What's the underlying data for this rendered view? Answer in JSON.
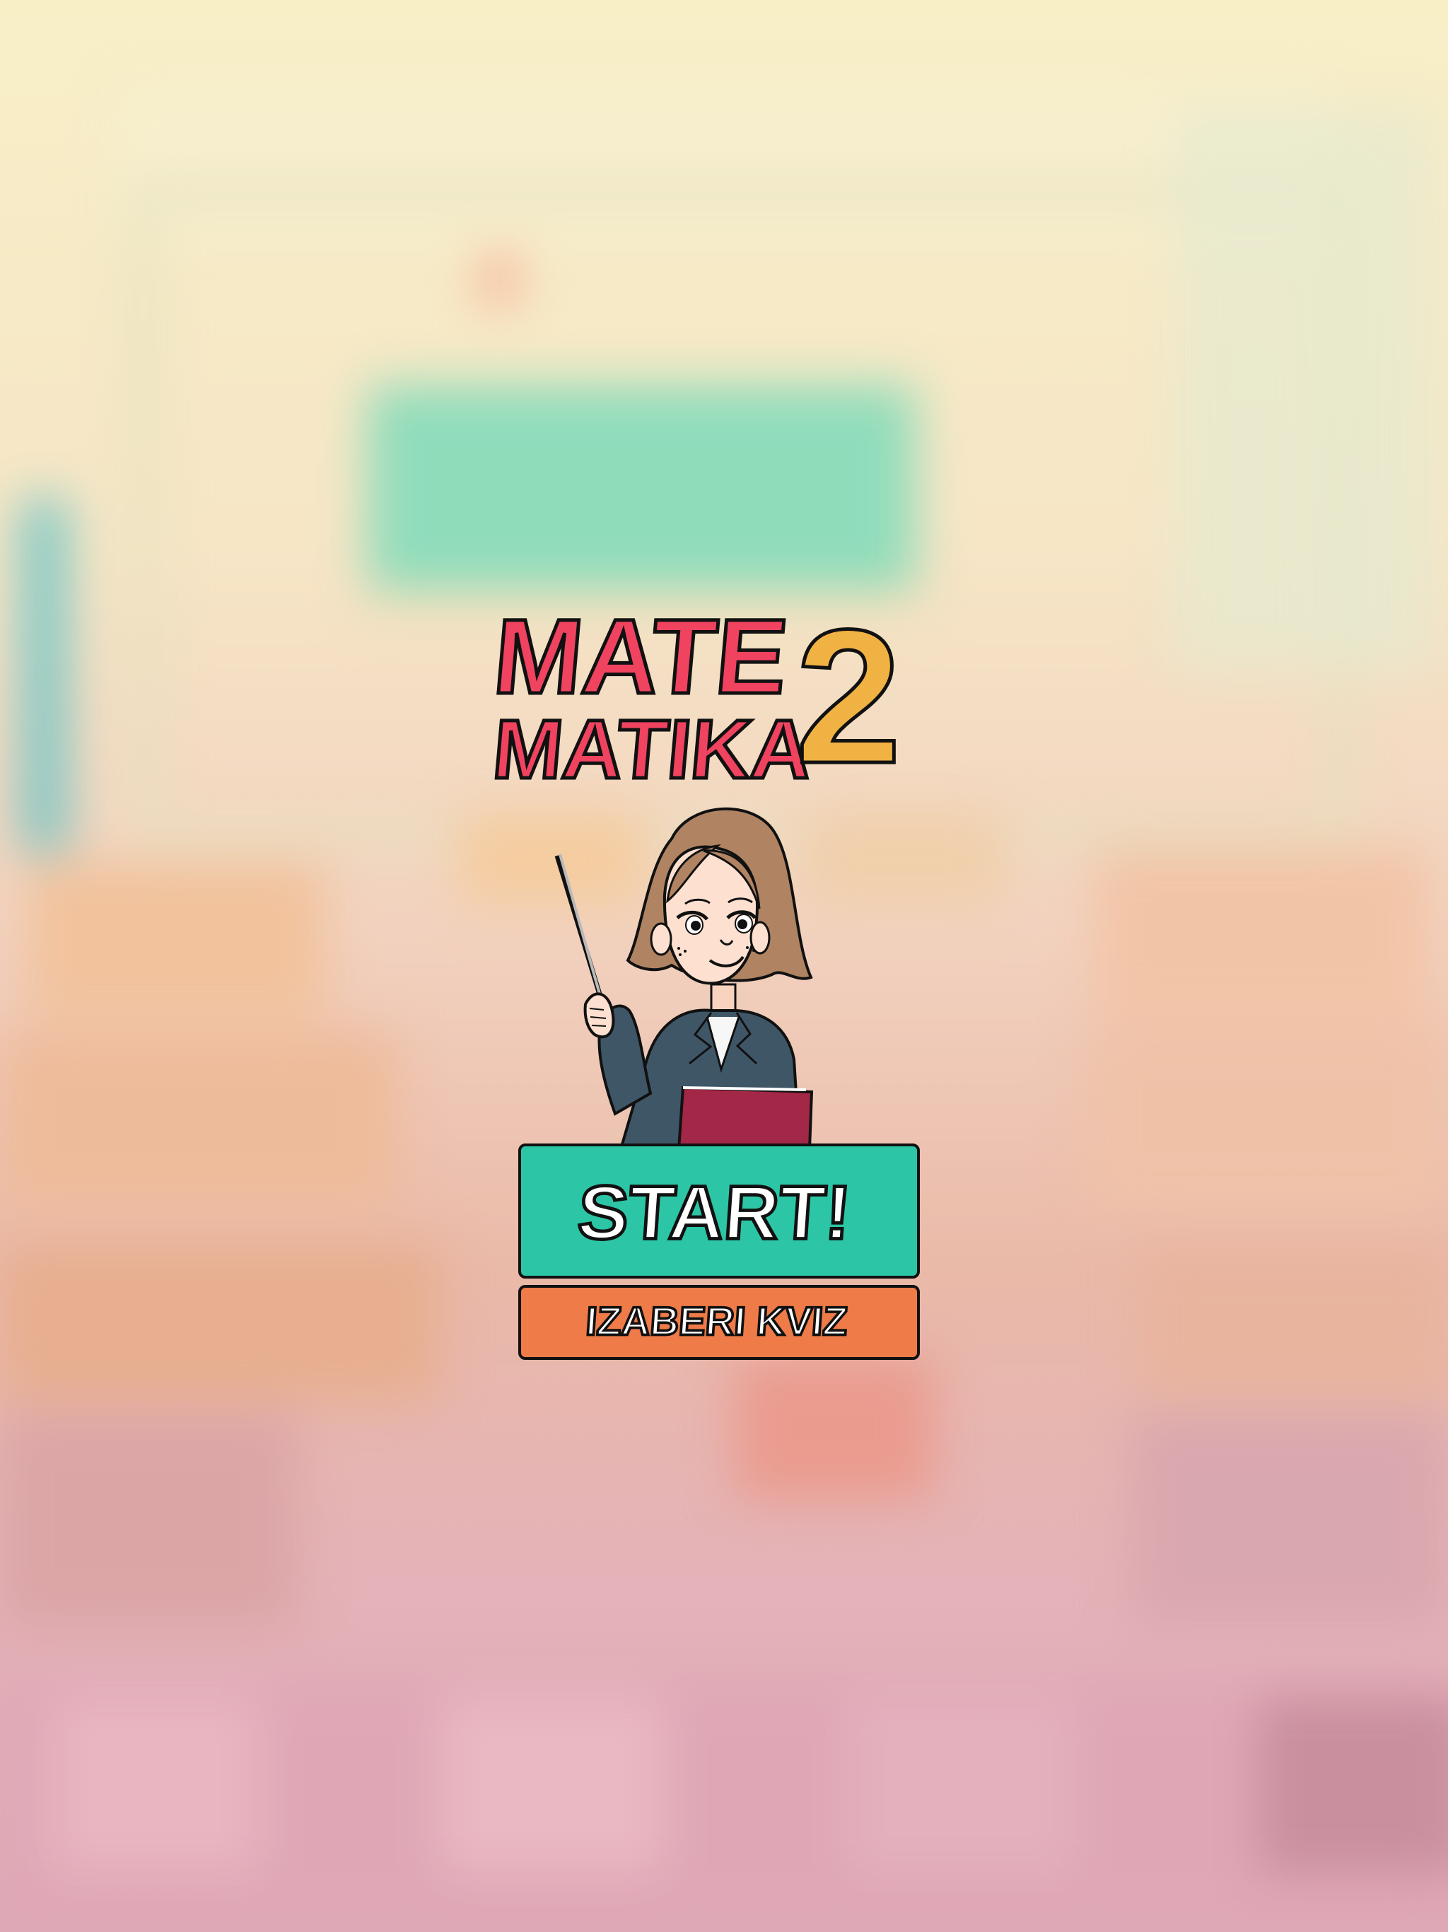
{
  "title": {
    "line1": "MATE",
    "line2": "MATIKA",
    "number": "2"
  },
  "buttons": {
    "start": "START!",
    "choose_quiz": "IZABERI KVIZ"
  },
  "colors": {
    "title_red": "#ef4360",
    "title_yellow": "#f1b244",
    "start_green": "#2cc6a6",
    "quiz_orange": "#ee7b48",
    "outline": "#111111"
  },
  "icons": {
    "character": "teacher-with-pointer",
    "background": "blurred-classroom"
  }
}
